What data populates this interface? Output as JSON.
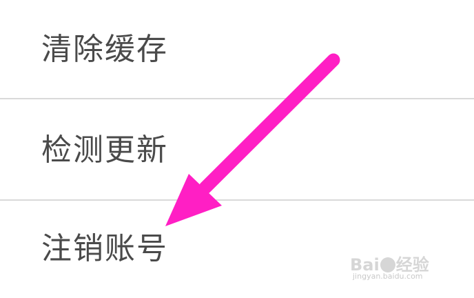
{
  "settings": {
    "items": [
      {
        "label": "清除缓存"
      },
      {
        "label": "检测更新"
      },
      {
        "label": "注销账号"
      }
    ]
  },
  "annotation": {
    "arrow_color": "#ff1fc4",
    "arrow_icon": "pointer-arrow-icon"
  },
  "watermark": {
    "logo_text_left": "Bai",
    "logo_text_right": "经验",
    "url": "jingyan.baidu.com"
  },
  "colors": {
    "background": "#ffffff",
    "text": "#4a4a4a",
    "divider": "#d9d9d9"
  }
}
